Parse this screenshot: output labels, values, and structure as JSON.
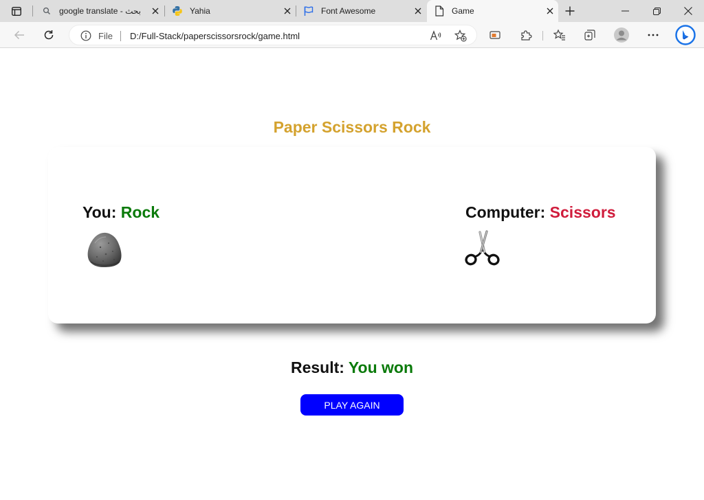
{
  "browser": {
    "tabs": [
      {
        "title": "google translate - بحث",
        "favicon": "search-icon"
      },
      {
        "title": "Yahia",
        "favicon": "python-icon"
      },
      {
        "title": "Font Awesome",
        "favicon": "flag-icon"
      },
      {
        "title": "Game",
        "favicon": "page-icon",
        "active": true
      }
    ],
    "address_bar": {
      "scheme_label": "File",
      "url": "D:/Full-Stack/paperscissorsrock/game.html"
    }
  },
  "game": {
    "title": "Paper Scissors Rock",
    "you_label": "You:",
    "you_choice": "Rock",
    "computer_label": "Computer:",
    "computer_choice": "Scissors",
    "result_label": "Result:",
    "result_value": "You won",
    "play_again_label": "PLAY AGAIN",
    "you_icon": "rock-icon",
    "computer_icon": "scissors-icon"
  },
  "colors": {
    "title": "#d4a22e",
    "win": "#0a7a0a",
    "lose": "#d01c3c",
    "button": "#0000ff"
  }
}
